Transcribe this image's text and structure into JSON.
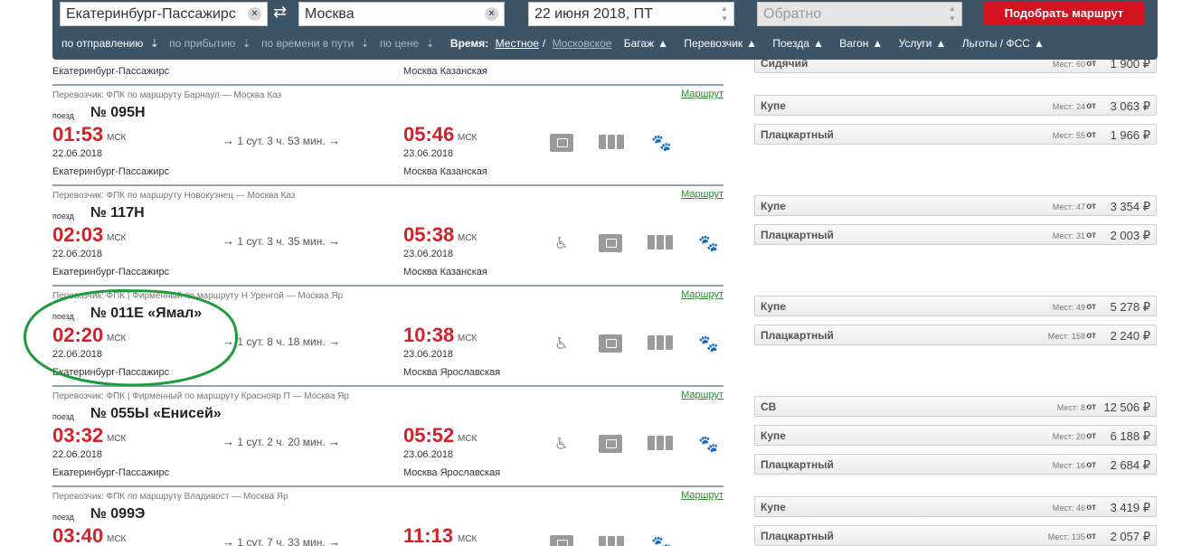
{
  "search": {
    "from": "Екатеринбург-Пассажирс",
    "to": "Москва",
    "date": "22 июня 2018, ПТ",
    "return_placeholder": "Обратно",
    "find_label": "Подобрать маршрут",
    "swap_icon": "swap-arrows-icon",
    "clear_icon": "×"
  },
  "sort_bar": {
    "by_departure": "по отправлению",
    "by_arrival": "по прибытию",
    "by_travel_time": "по времени в пути",
    "by_price": "по цене",
    "time_label": "Время:",
    "time_local": "Местное",
    "time_sep": "/",
    "time_moscow": "Московское",
    "filters": [
      "Багаж",
      "Перевозчик",
      "Поезда",
      "Вагон",
      "Услуги",
      "Льготы / ФСС"
    ]
  },
  "top_partial": {
    "from_station": "Екатеринбург-Пассажирс",
    "to_station": "Москва Казанская",
    "class": {
      "name": "Сидячий",
      "seats_label": "Мест:",
      "seats": "60",
      "from": "от",
      "price": "1 900 ₽"
    }
  },
  "trains": [
    {
      "meta": "Перевозчик: ФПК    по маршруту Барнаул — Москва Каз",
      "route_link": "Маршрут",
      "poezd": "поезд",
      "number": "№ 095Н",
      "dep_time": "01:53",
      "tz": "МСК",
      "dep_date": "22.06.2018",
      "dep_station": "Екатеринбург-Пассажирс",
      "duration": "1 сут. 3 ч. 53 мин.",
      "arr_time": "05:46",
      "arr_date": "23.06.2018",
      "arr_station": "Москва Казанская",
      "classes": [
        {
          "name": "Купе",
          "seats_label": "Мест:",
          "seats": "24",
          "from": "от",
          "price": "3 063 ₽"
        },
        {
          "name": "Плацкартный",
          "seats_label": "Мест:",
          "seats": "55",
          "from": "от",
          "price": "1 966 ₽"
        }
      ]
    },
    {
      "meta": "Перевозчик: ФПК    по маршруту Новокузнец — Москва Каз",
      "route_link": "Маршрут",
      "poezd": "поезд",
      "number": "№ 117Н",
      "dep_time": "02:03",
      "tz": "МСК",
      "dep_date": "22.06.2018",
      "dep_station": "Екатеринбург-Пассажирс",
      "duration": "1 сут. 3 ч. 35 мин.",
      "arr_time": "05:38",
      "arr_date": "23.06.2018",
      "arr_station": "Москва Казанская",
      "classes": [
        {
          "name": "Купе",
          "seats_label": "Мест:",
          "seats": "47",
          "from": "от",
          "price": "3 354 ₽"
        },
        {
          "name": "Плацкартный",
          "seats_label": "Мест:",
          "seats": "31",
          "from": "от",
          "price": "2 003 ₽"
        }
      ]
    },
    {
      "meta": "Перевозчик: ФПК | Фирменный    по маршруту Н Уренгой — Москва Яр",
      "route_link": "Маршрут",
      "poezd": "поезд",
      "number": "№ 011Е «Ямал»",
      "dep_time": "02:20",
      "tz": "МСК",
      "dep_date": "22.06.2018",
      "dep_station": "Екатеринбург-Пассажирс",
      "duration": "1 сут. 8 ч. 18 мин.",
      "arr_time": "10:38",
      "arr_date": "23.06.2018",
      "arr_station": "Москва Ярославская",
      "classes": [
        {
          "name": "Купе",
          "seats_label": "Мест:",
          "seats": "49",
          "from": "от",
          "price": "5 278 ₽"
        },
        {
          "name": "Плацкартный",
          "seats_label": "Мест:",
          "seats": "158",
          "from": "от",
          "price": "2 240 ₽"
        }
      ]
    },
    {
      "meta": "Перевозчик: ФПК | Фирменный    по маршруту Краснояр П — Москва Яр",
      "route_link": "Маршрут",
      "poezd": "поезд",
      "number": "№ 055Ы «Енисей»",
      "dep_time": "03:32",
      "tz": "МСК",
      "dep_date": "22.06.2018",
      "dep_station": "Екатеринбург-Пассажирс",
      "duration": "1 сут. 2 ч. 20 мин.",
      "arr_time": "05:52",
      "arr_date": "23.06.2018",
      "arr_station": "Москва Ярославская",
      "classes": [
        {
          "name": "СВ",
          "seats_label": "Мест:",
          "seats": "8",
          "from": "от",
          "price": "12 506 ₽"
        },
        {
          "name": "Купе",
          "seats_label": "Мест:",
          "seats": "20",
          "from": "от",
          "price": "6 188 ₽"
        },
        {
          "name": "Плацкартный",
          "seats_label": "Мест:",
          "seats": "16",
          "from": "от",
          "price": "2 684 ₽"
        }
      ]
    },
    {
      "meta": "Перевозчик: ФПК    по маршруту Владивост — Москва Яр",
      "route_link": "Маршрут",
      "poezd": "поезд",
      "number": "№ 099Э",
      "dep_time": "03:40",
      "tz": "МСК",
      "duration": "1 сут. 7 ч. 33 мин.",
      "arr_time": "11:13",
      "classes": [
        {
          "name": "Купе",
          "seats_label": "Мест:",
          "seats": "46",
          "from": "от",
          "price": "3 419 ₽"
        },
        {
          "name": "Плацкартный",
          "seats_label": "Мест:",
          "seats": "135",
          "from": "от",
          "price": "2 057 ₽"
        }
      ]
    }
  ],
  "colors": {
    "panel": "#3d5366",
    "accent_red": "#d42027",
    "button_red": "#d31321",
    "link_green": "#2e8b2e",
    "ellipse_green": "#1f9a3a"
  }
}
